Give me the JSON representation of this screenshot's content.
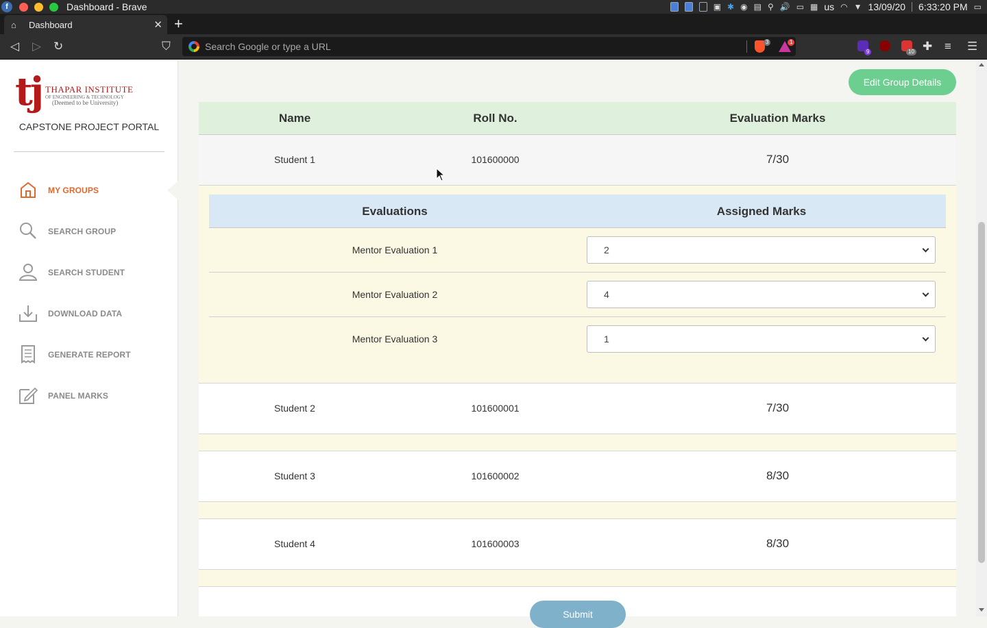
{
  "os": {
    "window_title": "Dashboard - Brave",
    "keyboard_layout": "us",
    "date": "13/09/20",
    "time": "6:33:20 PM"
  },
  "browser": {
    "tab_title": "Dashboard",
    "url_placeholder": "Search Google or type a URL",
    "brave_shield_count": "3",
    "rewards_count": "1",
    "ext_badge_1": "9",
    "ext_badge_2": "10"
  },
  "sidebar": {
    "brand": {
      "logo_letters": "tj",
      "institute": "THAPAR INSTITUTE",
      "subtitle": "OF ENGINEERING & TECHNOLOGY",
      "deemed": "(Deemed to be University)"
    },
    "portal_title": "CAPSTONE PROJECT PORTAL",
    "items": [
      {
        "label": "MY GROUPS",
        "icon": "home-icon",
        "active": true
      },
      {
        "label": "SEARCH GROUP",
        "icon": "search-icon",
        "active": false
      },
      {
        "label": "SEARCH STUDENT",
        "icon": "user-icon",
        "active": false
      },
      {
        "label": "DOWNLOAD DATA",
        "icon": "download-icon",
        "active": false
      },
      {
        "label": "GENERATE REPORT",
        "icon": "report-icon",
        "active": false
      },
      {
        "label": "PANEL MARKS",
        "icon": "edit-icon",
        "active": false
      }
    ],
    "active_color": "#e0682c"
  },
  "main": {
    "edit_button": "Edit Group Details",
    "table": {
      "headers": [
        "Name",
        "Roll No.",
        "Evaluation Marks"
      ],
      "rows": [
        {
          "name": "Student 1",
          "roll": "101600000",
          "marks": "7/30"
        },
        {
          "name": "Student 2",
          "roll": "101600001",
          "marks": "7/30"
        },
        {
          "name": "Student 3",
          "roll": "101600002",
          "marks": "8/30"
        },
        {
          "name": "Student 4",
          "roll": "101600003",
          "marks": "8/30"
        }
      ]
    },
    "subtable": {
      "headers": [
        "Evaluations",
        "Assigned Marks"
      ],
      "rows": [
        {
          "evaluation": "Mentor Evaluation 1",
          "marks": "2"
        },
        {
          "evaluation": "Mentor Evaluation 2",
          "marks": "4"
        },
        {
          "evaluation": "Mentor Evaluation 3",
          "marks": "1"
        }
      ]
    },
    "submit_label": "Submit"
  },
  "colors": {
    "header_green": "#dff1dd",
    "sub_header_blue": "#d8e8f4",
    "expanded_yellow": "#fbf9e3",
    "edit_button": "#6ccf8f",
    "submit_button": "#7fb2ca"
  }
}
